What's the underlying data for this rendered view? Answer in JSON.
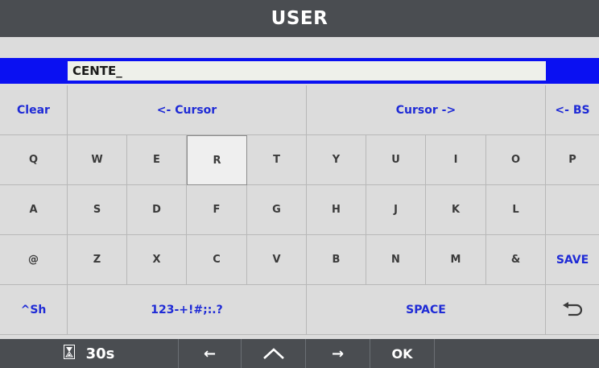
{
  "title": "USER",
  "input": {
    "value": "CENTE_"
  },
  "keyboard": {
    "row0": [
      "Clear",
      "<- Cursor",
      "Cursor ->",
      "<- BS"
    ],
    "row1": [
      "Q",
      "W",
      "E",
      "R",
      "T",
      "Y",
      "U",
      "I",
      "O",
      "P"
    ],
    "row2": [
      "A",
      "S",
      "D",
      "F",
      "G",
      "H",
      "J",
      "K",
      "L",
      ""
    ],
    "row3": [
      "@",
      "Z",
      "X",
      "C",
      "V",
      "B",
      "N",
      "M",
      "&",
      "SAVE"
    ],
    "row4": [
      "^Sh",
      "123-+!#;:.?",
      "SPACE"
    ],
    "selected_key": "R"
  },
  "bottom": {
    "timer": "30s",
    "timer_icon": "hourglass-icon",
    "left_arrow": "←",
    "up_icon": "caret-up-icon",
    "right_arrow": "→",
    "ok": "OK"
  },
  "colors": {
    "accent_blue": "#0a10f2",
    "key_text_blue": "#1f2bd6",
    "bar": "#4a4d51"
  }
}
